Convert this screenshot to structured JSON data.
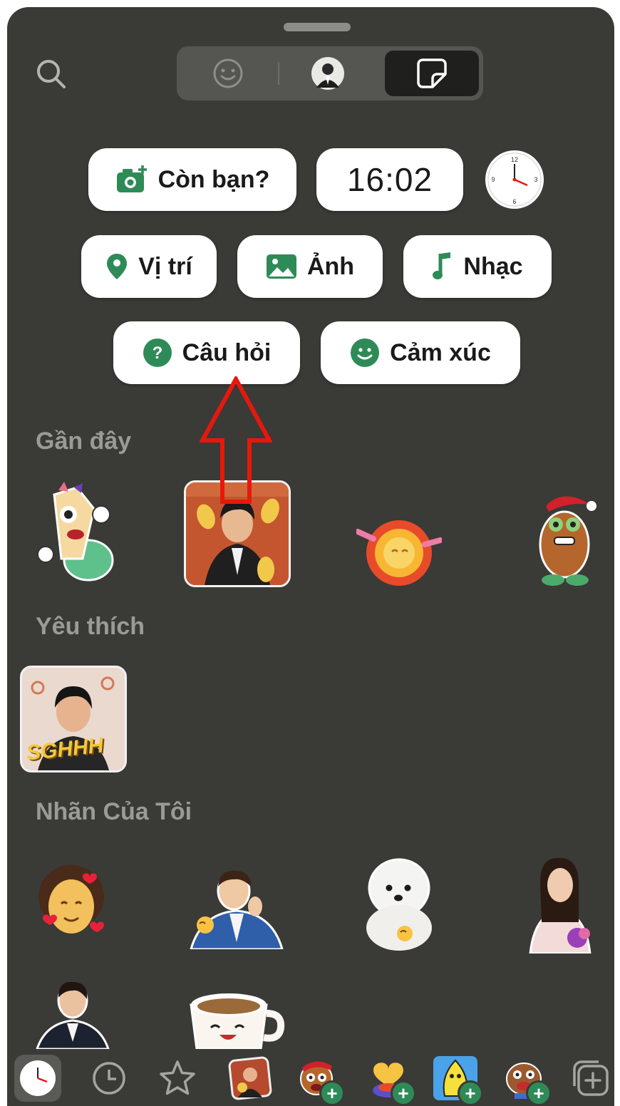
{
  "tabs": [
    {
      "name": "emoji-tab",
      "icon": "smiley-icon",
      "active": false
    },
    {
      "name": "avatar-tab",
      "icon": "profile-avatar",
      "active": false
    },
    {
      "name": "sticker-tab",
      "icon": "sticker-icon",
      "active": true
    }
  ],
  "actions": {
    "your_turn": "Còn bạn?",
    "time": "16:02",
    "location": "Vị trí",
    "photo": "Ảnh",
    "music": "Nhạc",
    "question": "Câu hỏi",
    "emotion": "Cảm xúc"
  },
  "sections": {
    "recent": "Gần đây",
    "favorites": "Yêu thích",
    "my_stickers": "Nhãn Của Tôi"
  },
  "favorite_sticker_text": "SGHHH",
  "bottom_bar": [
    {
      "icon": "clock-sticker-icon",
      "active": true
    },
    {
      "icon": "history-icon"
    },
    {
      "icon": "star-icon"
    },
    {
      "icon": "photo-sticker-icon"
    },
    {
      "icon": "cartoon-sticker-pack",
      "add": true
    },
    {
      "icon": "heart-sticker-pack",
      "add": true
    },
    {
      "icon": "yellow-creature-pack",
      "add": true
    },
    {
      "icon": "monster-sticker-pack",
      "add": true
    },
    {
      "icon": "add-sticker-icon"
    }
  ],
  "colors": {
    "background": "#3a3a37",
    "accent_green": "#2e8b57",
    "highlight_red": "#e8170c",
    "pill": "#ffffff"
  }
}
